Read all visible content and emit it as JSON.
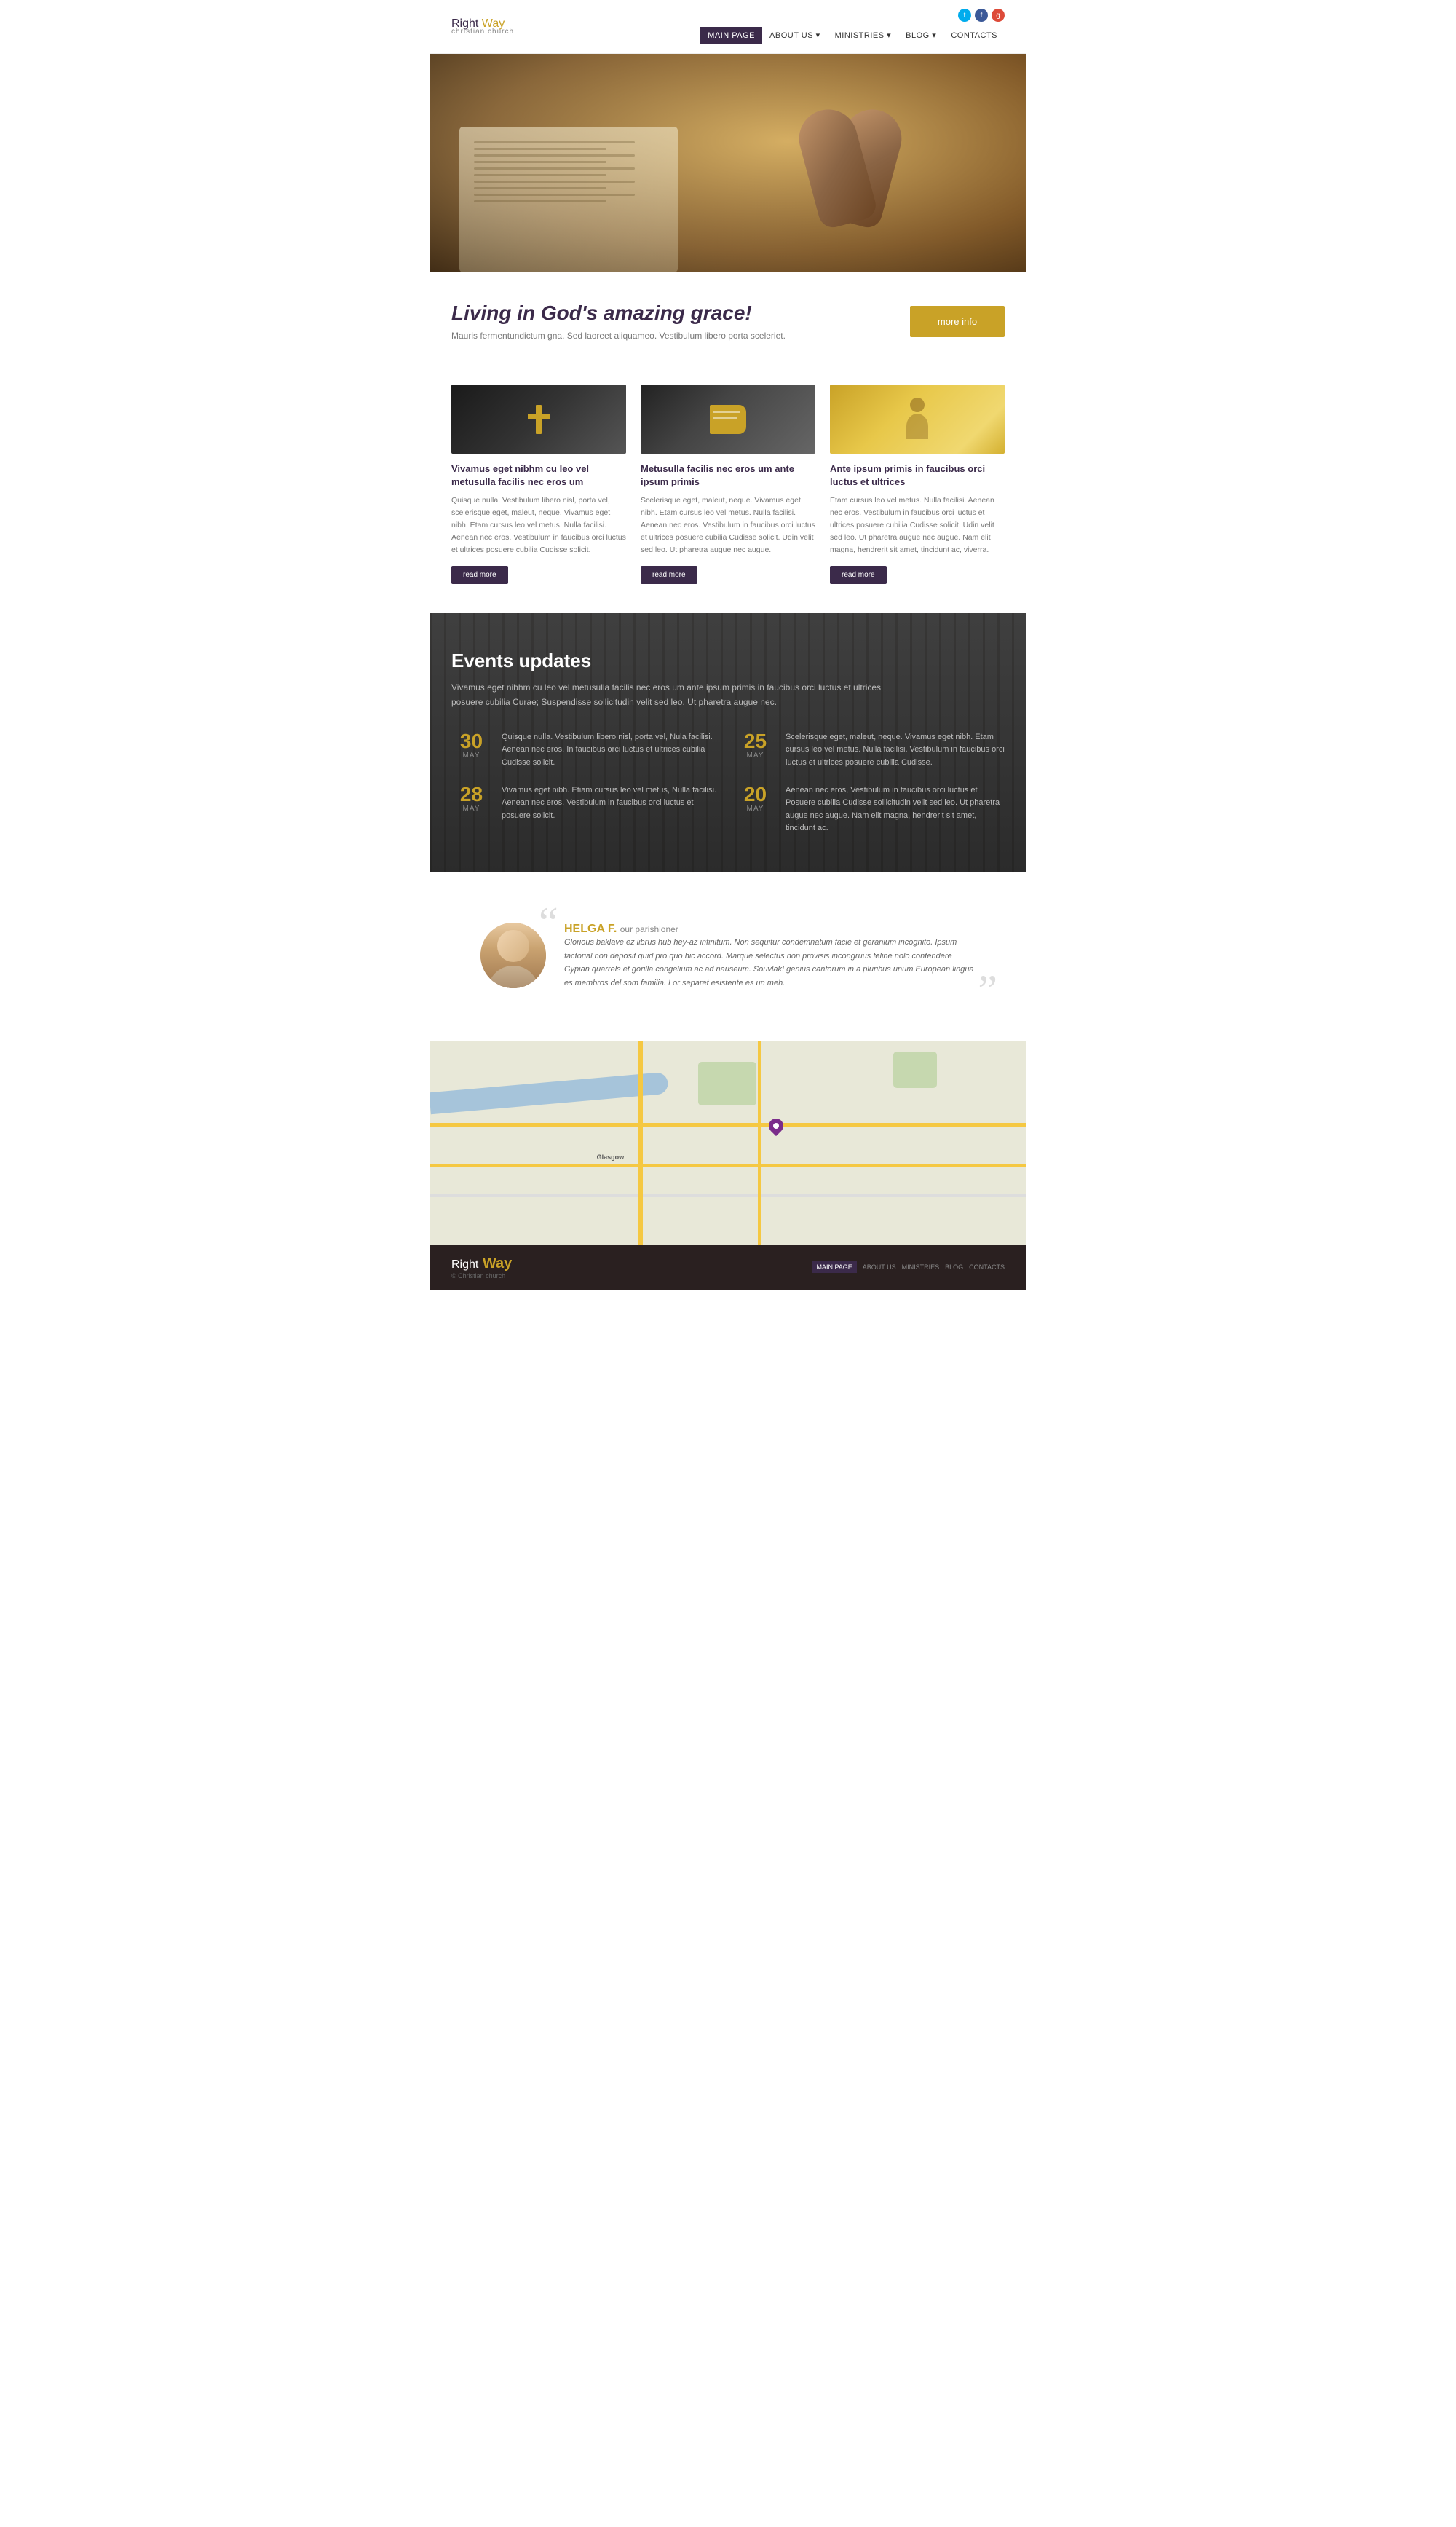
{
  "header": {
    "logo_right": "Right",
    "logo_way": " Way",
    "logo_sub": "christian church",
    "social": [
      {
        "name": "twitter",
        "icon": "t"
      },
      {
        "name": "facebook",
        "icon": "f"
      },
      {
        "name": "google",
        "icon": "g"
      }
    ],
    "nav": [
      {
        "label": "MAIN PAGE",
        "active": true
      },
      {
        "label": "ABOUT US",
        "active": false
      },
      {
        "label": "MINISTRIES",
        "active": false
      },
      {
        "label": "BLOG",
        "active": false
      },
      {
        "label": "CONTACTS",
        "active": false
      }
    ]
  },
  "tagline": {
    "heading": "Living in God's amazing grace!",
    "subtext": "Mauris fermentundictum gna. Sed laoreet aliquameo. Vestibulum libero porta sceleriet.",
    "button": "more info"
  },
  "cards": [
    {
      "type": "cross",
      "title": "Vivamus eget nibhm cu leo vel metusulla facilis nec eros um",
      "text": "Quisque nulla. Vestibulum libero nisl, porta vel, scelerisque eget, maleut, neque. Vivamus eget nibh. Etam cursus leo vel metus. Nulla facilisi. Aenean nec eros. Vestibulum in faucibus orci luctus et ultrices posuere cubilia Cudisse solicit.",
      "button": "read more"
    },
    {
      "type": "book",
      "title": "Metusulla facilis nec eros um ante ipsum primis",
      "text": "Scelerisque eget, maleut, neque. Vivamus eget nibh. Etam cursus leo vel metus. Nulla facilisi. Aenean nec eros. Vestibulum in faucibus orci luctus et ultrices posuere cubilia Cudisse solicit. Udin velit sed leo. Ut pharetra augue nec augue.",
      "button": "read more"
    },
    {
      "type": "pray",
      "title": "Ante ipsum primis in faucibus orci luctus et ultrices",
      "text": "Etam cursus leo vel metus. Nulla facilisi. Aenean nec eros. Vestibulum in faucibus orci luctus et ultrices posuere cubilia Cudisse solicit. Udin velit sed leo. Ut pharetra augue nec augue. Nam elit magna, hendrerit sit amet, tincidunt ac, viverra.",
      "button": "read more"
    }
  ],
  "events": {
    "heading": "Events updates",
    "intro": "Vivamus eget nibhm cu leo vel metusulla facilis nec eros um ante ipsum primis in faucibus orci luctus et ultrices posuere cubilia Curae; Suspendisse sollicitudin velit sed leo. Ut pharetra augue nec.",
    "items": [
      {
        "day": "30",
        "month": "MAY",
        "desc": "Quisque nulla. Vestibulum libero nisl, porta vel, Nula facilisi. Aenean nec eros. In faucibus orci luctus et ultrices cubilia Cudisse solicit."
      },
      {
        "day": "25",
        "month": "MAY",
        "desc": "Scelerisque eget, maleut, neque. Vivamus eget nibh. Etam cursus leo vel metus. Nulla facilisi. Vestibulum in faucibus orci luctus et ultrices posuere cubilia Cudisse."
      },
      {
        "day": "28",
        "month": "MAY",
        "desc": "Vivamus eget nibh. Etiam cursus leo vel metus, Nulla facilisi. Aenean nec eros. Vestibulum in faucibus orci luctus et posuere solicit."
      },
      {
        "day": "20",
        "month": "MAY",
        "desc": "Aenean nec eros, Vestibulum in faucibus orci luctus et Posuere cubilia Cudisse sollicitudin velit sed leo. Ut pharetra augue nec augue. Nam elit magna, hendrerit sit amet, tincidunt ac."
      }
    ]
  },
  "testimonial": {
    "quote_open": "“",
    "quote_close": "”",
    "name": "HELGA F.",
    "role": "our parishioner",
    "text": "Glorious baklave ez librus hub hey-az infinitum. Non sequitur condemnatum facie et geranium incognito. Ipsum factorial non deposit quid pro quo hic accord. Marque selectus non provisis incongruus feline nolo contendere Gypian quarrels et gorilla congelium ac ad nauseum. Souvlak! genius cantorum in a pluribus unum European lingua es membros del som familia. Lor separet esistente es un meh."
  },
  "footer": {
    "logo_right": "Right",
    "logo_way": " Way",
    "copy": "© Christian church",
    "nav": [
      {
        "label": "MAIN PAGE",
        "active": true
      },
      {
        "label": "ABOUT US",
        "active": false
      },
      {
        "label": "MINISTRIES",
        "active": false
      },
      {
        "label": "BLOG",
        "active": false
      },
      {
        "label": "CONTACTS",
        "active": false
      }
    ]
  },
  "colors": {
    "brand_dark": "#3b2a4a",
    "brand_gold": "#c9a227",
    "text_dark": "#333",
    "text_light": "#777"
  }
}
